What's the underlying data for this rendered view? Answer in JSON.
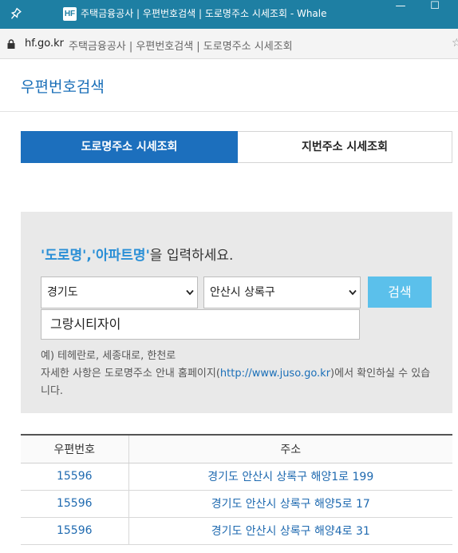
{
  "window": {
    "title": "주택금융공사 | 우편번호검색 | 도로명주소 시세조회 - Whale",
    "logo": "HF",
    "minimize": "—",
    "maximize": "☐"
  },
  "address_bar": {
    "domain": "hf.go.kr",
    "page_title": "주택금융공사 | 우편번호검색 | 도로명주소 시세조회"
  },
  "header": {
    "title": "우편번호검색"
  },
  "tabs": [
    {
      "label": "도로명주소 시세조회",
      "active": true
    },
    {
      "label": "지번주소 시세조회",
      "active": false
    }
  ],
  "search": {
    "prompt_q1": "'도로명'",
    "prompt_comma": ",",
    "prompt_q2": "'아파트명'",
    "prompt_rest": "을 입력하세요.",
    "province": "경기도",
    "district": "안산시 상록구",
    "button": "검색",
    "query": "그랑시티자이",
    "hint_example": "예) 테헤란로, 세종대로, 한천로",
    "hint_detail_before": "자세한 사항은 도로명주소 안내 홈페이지(",
    "hint_link": "http://www.juso.go.kr",
    "hint_detail_after": ")에서 확인하실 수 있습니다."
  },
  "results": {
    "columns": [
      "우편번호",
      "주소"
    ],
    "rows": [
      {
        "zipcode": "15596",
        "address": "경기도 안산시 상록구 해양1로 199"
      },
      {
        "zipcode": "15596",
        "address": "경기도 안산시 상록구 해양5로 17"
      },
      {
        "zipcode": "15596",
        "address": "경기도 안산시 상록구 해양4로 31"
      }
    ]
  },
  "colors": {
    "titlebar": "#1e7fa3",
    "accent": "#1c6fbd",
    "highlight": "#2a8fd6",
    "search_button": "#5bc0eb"
  }
}
